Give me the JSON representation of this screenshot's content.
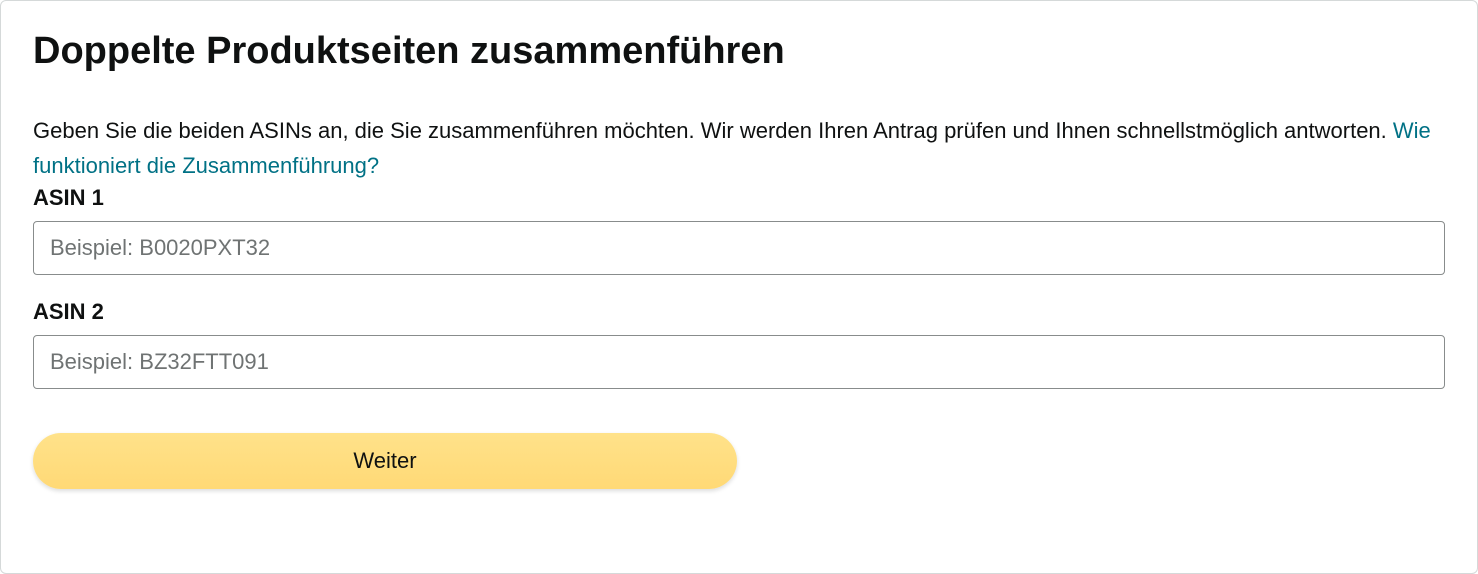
{
  "header": {
    "title": "Doppelte Produktseiten zusammenführen"
  },
  "intro": {
    "text_before_link": "Geben Sie die beiden ASINs an, die Sie zusammenführen möchten. Wir werden Ihren Antrag prüfen und Ihnen schnellstmöglich antworten. ",
    "link_text": "Wie funktioniert die Zusammenführung?"
  },
  "form": {
    "asin1": {
      "label": "ASIN 1",
      "placeholder": "Beispiel: B0020PXT32",
      "value": ""
    },
    "asin2": {
      "label": "ASIN 2",
      "placeholder": "Beispiel: BZ32FTT091",
      "value": ""
    },
    "submit_label": "Weiter"
  }
}
